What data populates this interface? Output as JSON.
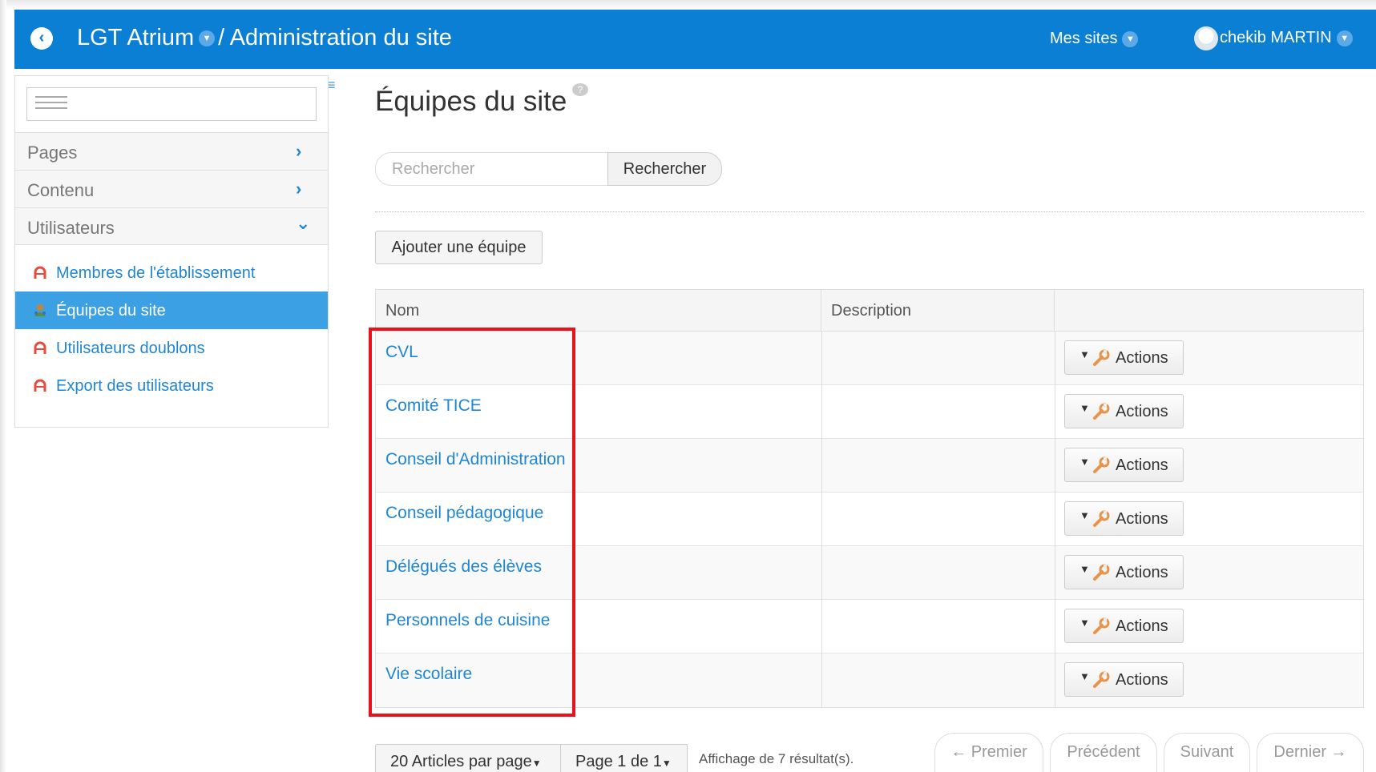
{
  "header": {
    "site_name": "LGT Atrium",
    "separator": "/",
    "section_title": "Administration du site",
    "my_sites_label": "Mes sites",
    "user_name": "chekib MARTIN"
  },
  "sidebar": {
    "sections": [
      {
        "label": "Pages",
        "chevron": "›"
      },
      {
        "label": "Contenu",
        "chevron": "›"
      },
      {
        "label": "Utilisateurs",
        "chevron": "⌄"
      }
    ],
    "items": [
      {
        "label": "Membres de l'établissement",
        "icon": "user-arc-icon",
        "active": false
      },
      {
        "label": "Équipes du site",
        "icon": "users-group-icon",
        "active": true
      },
      {
        "label": "Utilisateurs doublons",
        "icon": "user-arc-icon",
        "active": false
      },
      {
        "label": "Export des utilisateurs",
        "icon": "user-arc-icon",
        "active": false
      }
    ]
  },
  "main": {
    "title": "Équipes du site",
    "search": {
      "placeholder": "Rechercher",
      "value": "",
      "button_label": "Rechercher"
    },
    "add_button_label": "Ajouter une équipe",
    "table": {
      "columns": [
        "Nom",
        "Description",
        ""
      ],
      "rows": [
        {
          "name": "CVL",
          "description": "",
          "action_label": "Actions"
        },
        {
          "name": "Comité TICE",
          "description": "",
          "action_label": "Actions"
        },
        {
          "name": "Conseil d'Administration",
          "description": "",
          "action_label": "Actions"
        },
        {
          "name": "Conseil pédagogique",
          "description": "",
          "action_label": "Actions"
        },
        {
          "name": "Délégués des élèves",
          "description": "",
          "action_label": "Actions"
        },
        {
          "name": "Personnels de cuisine",
          "description": "",
          "action_label": "Actions"
        },
        {
          "name": "Vie scolaire",
          "description": "",
          "action_label": "Actions"
        }
      ]
    },
    "pagination": {
      "per_page_label": "20 Articles par page",
      "page_label": "Page 1 de 1",
      "results_text": "Affichage de 7 résultat(s).",
      "first_label": "← Premier",
      "prev_label": "Précédent",
      "next_label": "Suivant",
      "last_label": "Dernier →"
    }
  },
  "colors": {
    "header_bg": "#0a7fd4",
    "link": "#1f86d6",
    "active_item_bg": "#3ba0e4",
    "highlight_box": "#e8121c",
    "user_icon": "#e84a3c"
  }
}
